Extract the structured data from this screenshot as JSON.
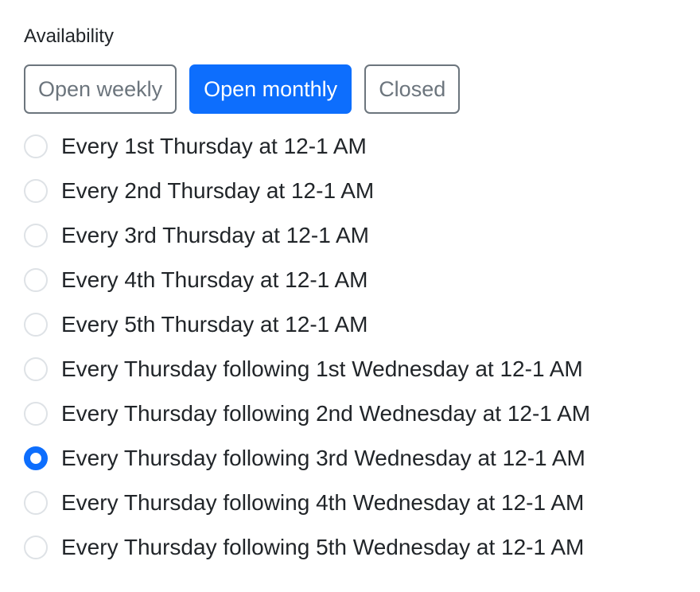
{
  "availability": {
    "label": "Availability",
    "options": [
      {
        "label": "Open weekly",
        "active": false
      },
      {
        "label": "Open monthly",
        "active": true
      },
      {
        "label": "Closed",
        "active": false
      }
    ]
  },
  "schedule": {
    "items": [
      {
        "label": "Every 1st Thursday at 12-1 AM",
        "checked": false
      },
      {
        "label": "Every 2nd Thursday at 12-1 AM",
        "checked": false
      },
      {
        "label": "Every 3rd Thursday at 12-1 AM",
        "checked": false
      },
      {
        "label": "Every 4th Thursday at 12-1 AM",
        "checked": false
      },
      {
        "label": "Every 5th Thursday at 12-1 AM",
        "checked": false
      },
      {
        "label": "Every Thursday following 1st Wednesday at 12-1 AM",
        "checked": false
      },
      {
        "label": "Every Thursday following 2nd Wednesday at 12-1 AM",
        "checked": false
      },
      {
        "label": "Every Thursday following 3rd Wednesday at 12-1 AM",
        "checked": true
      },
      {
        "label": "Every Thursday following 4th Wednesday at 12-1 AM",
        "checked": false
      },
      {
        "label": "Every Thursday following 5th Wednesday at 12-1 AM",
        "checked": false
      }
    ]
  },
  "colors": {
    "accent": "#0d6efd",
    "secondary": "#6c757d",
    "radio_border": "#dee2e6"
  }
}
